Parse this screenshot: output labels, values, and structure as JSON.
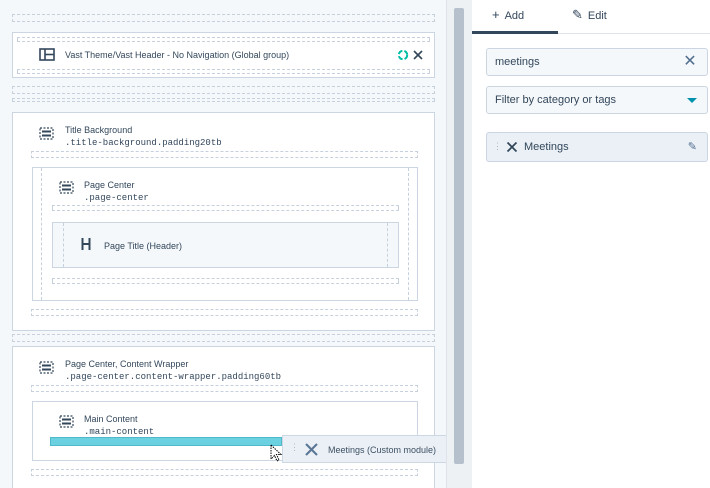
{
  "left": {
    "header_module": {
      "label": "Vast Theme/Vast Header - No Navigation (Global group)"
    },
    "section1": {
      "title": "Title Background",
      "class_name": ".title-background.padding20tb"
    },
    "section1_inner": {
      "title": "Page Center",
      "class_name": ".page-center"
    },
    "page_title_module": {
      "label": "Page Title (Header)"
    },
    "section2": {
      "title": "Page Center, Content Wrapper",
      "class_name": ".page-center.content-wrapper.padding60tb"
    },
    "section2_inner": {
      "title": "Main Content",
      "class_name": ".main-content"
    },
    "drag_chip": {
      "label": "Meetings (Custom module)"
    }
  },
  "right": {
    "tabs": [
      {
        "label": "Add",
        "icon": "plus-icon",
        "active": true
      },
      {
        "label": "Edit",
        "icon": "pencil-icon",
        "active": false
      }
    ],
    "search": {
      "value": "meetings"
    },
    "filter": {
      "label": "Filter by category or tags"
    },
    "results": [
      {
        "label": "Meetings",
        "icon": "meetings-icon"
      }
    ]
  },
  "colors": {
    "accent": "#0091ae",
    "drop_indicator": "#6bd0e0",
    "text": "#33475b",
    "border": "#cbd6e2"
  }
}
